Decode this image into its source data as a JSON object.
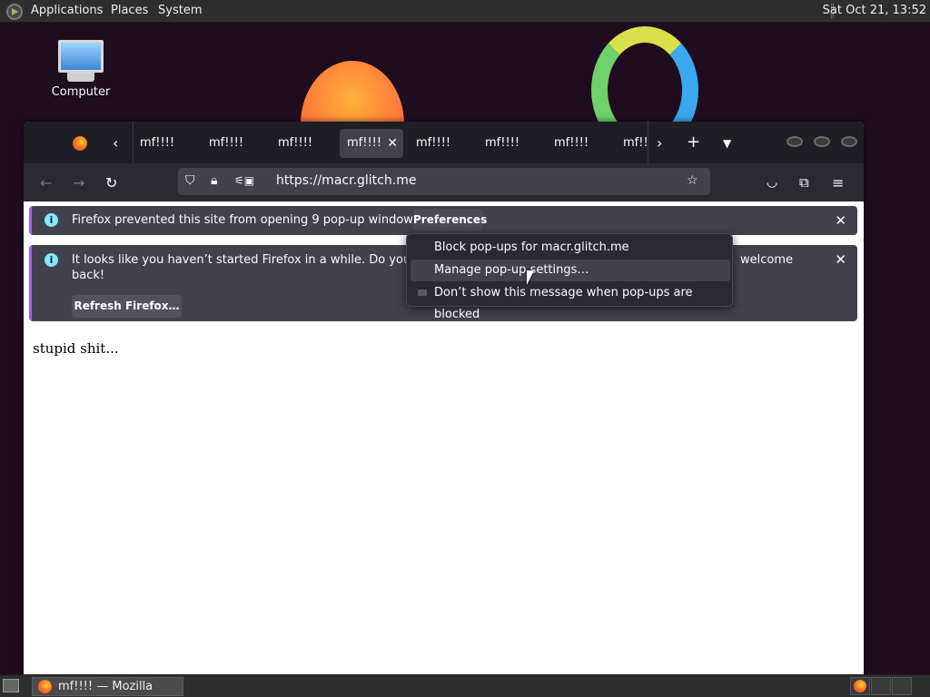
{
  "topbar": {
    "menus": [
      "Applications",
      "Places",
      "System"
    ],
    "clock": "Sat Oct 21, 13:52"
  },
  "desktop": {
    "icons": [
      {
        "label": "Computer",
        "icon": "computer-icon"
      }
    ]
  },
  "browser": {
    "tabs": [
      "mf!!!!",
      "mf!!!!",
      "mf!!!!",
      "mf!!!!",
      "mf!!!!",
      "mf!!!!",
      "mf!!!!",
      "mf!!!"
    ],
    "active_tab_index": 3,
    "url": "https://macr.glitch.me",
    "notifications": {
      "popup_blocked": {
        "text": "Firefox prevented this site from opening 9 pop-up windows.",
        "button": "Preferences"
      },
      "refresh": {
        "text_start": "It looks like you haven’t started Firefox in a while. Do you want t",
        "text_end": "welcome",
        "text_line2": "back!",
        "button": "Refresh Firefox…"
      }
    },
    "popup_menu": {
      "items": [
        "Block pop-ups for macr.glitch.me",
        "Manage pop-up settings…",
        "Don’t show this message when pop-ups are blocked"
      ],
      "hovered_index": 1
    },
    "page_text": "stupid shit..."
  },
  "taskbar": {
    "task_label": "mf!!!! — Mozilla Fire…"
  }
}
